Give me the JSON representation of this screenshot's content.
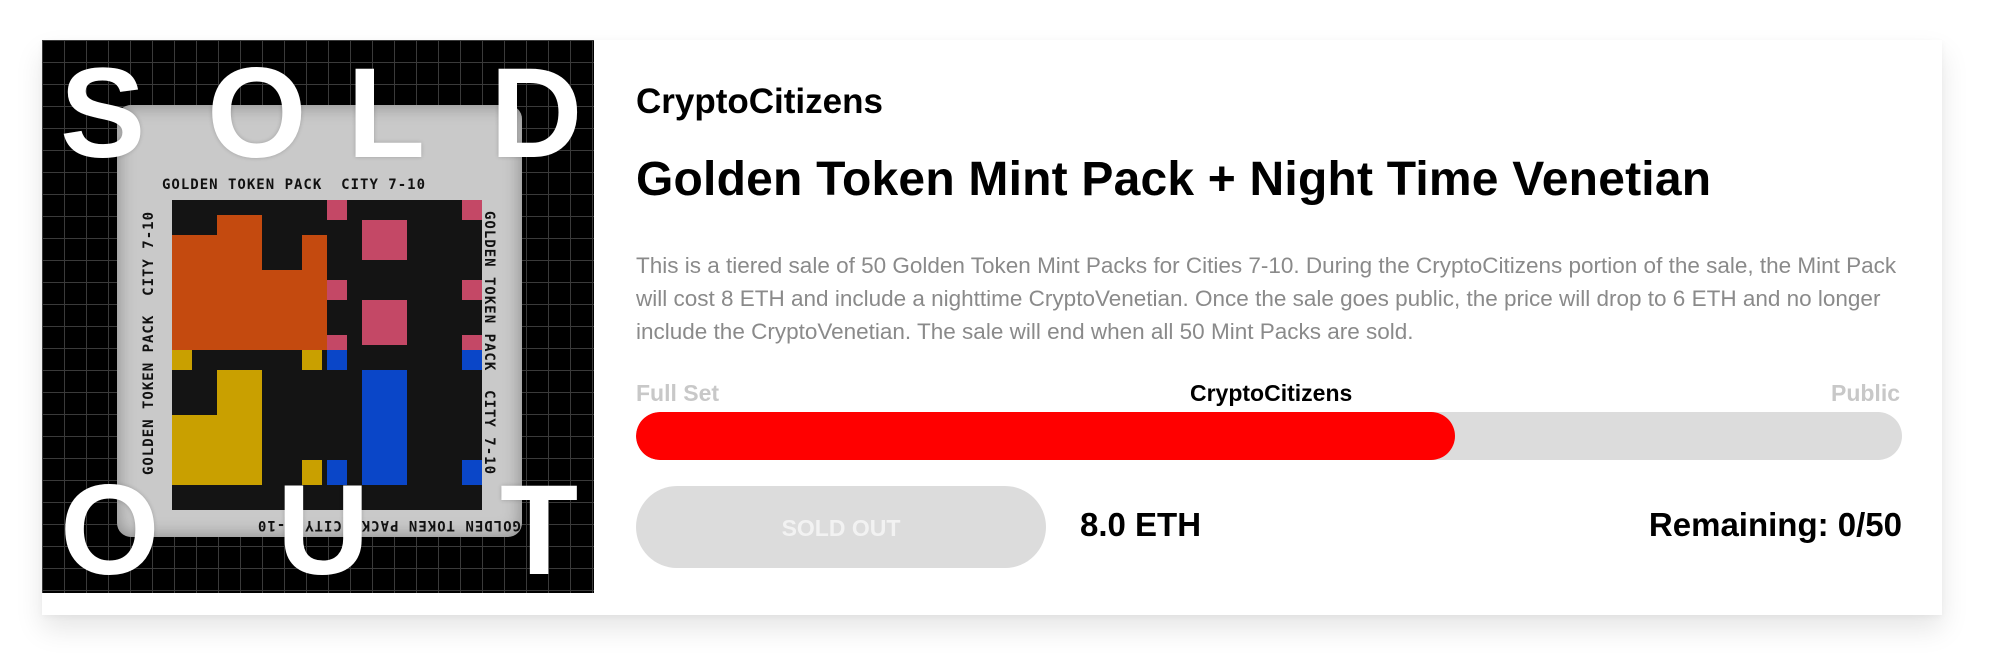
{
  "artwork": {
    "alt": "Golden Token Pack",
    "pack_label": "GOLDEN TOKEN PACK",
    "pack_city_label": "CITY 7-10",
    "overlay_top": [
      "S",
      "O",
      "L",
      "D"
    ],
    "overlay_bottom": [
      "O",
      "U",
      "T"
    ]
  },
  "collection": "CryptoCitizens",
  "title": "Golden Token Mint Pack + Night Time Venetian",
  "description": "This is a tiered sale of 50 Golden Token Mint Packs for Cities 7-10. During the CryptoCitizens portion of the sale, the Mint Pack will cost 8 ETH and include a nighttime CryptoVenetian. Once the sale goes public, the price will drop to 6 ETH and no longer include the CryptoVenetian. The sale will end when all 50 Mint Packs are sold.",
  "phases": {
    "left": "Full Set",
    "active": "CryptoCitizens",
    "right": "Public"
  },
  "progress": {
    "fraction": 0.647,
    "fill_color": "#ff0000",
    "track_color": "#dcdcdc"
  },
  "button": {
    "label": "SOLD OUT",
    "disabled": true
  },
  "price": "8.0 ETH",
  "remaining": "Remaining: 0/50"
}
